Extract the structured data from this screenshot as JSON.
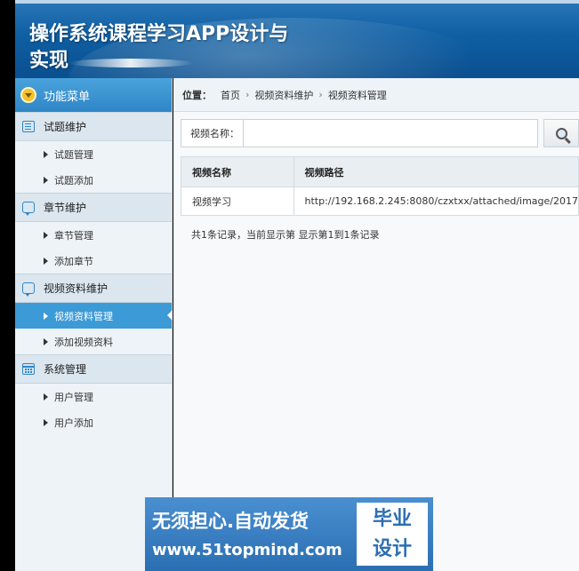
{
  "header": {
    "title": "操作系统课程学习APP设计与实现"
  },
  "sidebar": {
    "menu_title": "功能菜单",
    "groups": [
      {
        "title": "试题维护",
        "icon": "list-icon",
        "items": [
          {
            "label": "试题管理"
          },
          {
            "label": "试题添加"
          }
        ]
      },
      {
        "title": "章节维护",
        "icon": "chat-icon",
        "items": [
          {
            "label": "章节管理"
          },
          {
            "label": "添加章节"
          }
        ]
      },
      {
        "title": "视频资料维护",
        "icon": "chat-icon",
        "items": [
          {
            "label": "视频资料管理",
            "active": true
          },
          {
            "label": "添加视频资料"
          }
        ]
      },
      {
        "title": "系统管理",
        "icon": "calendar-icon",
        "items": [
          {
            "label": "用户管理"
          },
          {
            "label": "用户添加"
          }
        ]
      }
    ]
  },
  "breadcrumb": {
    "label": "位置：",
    "items": [
      "首页",
      "视频资料维护",
      "视频资料管理"
    ],
    "separator": "›"
  },
  "search": {
    "label": "视频名称：",
    "value": "",
    "button_icon": "search-icon"
  },
  "table": {
    "headers": [
      "视频名称",
      "视频路径"
    ],
    "rows": [
      [
        "视频学习",
        "http://192.168.2.245:8080/czxtxx/attached/image/2017"
      ]
    ]
  },
  "pagination": {
    "text": "共1条记录，当前显示第  显示第1到1条记录"
  },
  "watermark": {
    "line1": "无须担心.自动发货",
    "line2": "www.51topmind.com",
    "badge_line1": "毕业",
    "badge_line2": "设计"
  }
}
